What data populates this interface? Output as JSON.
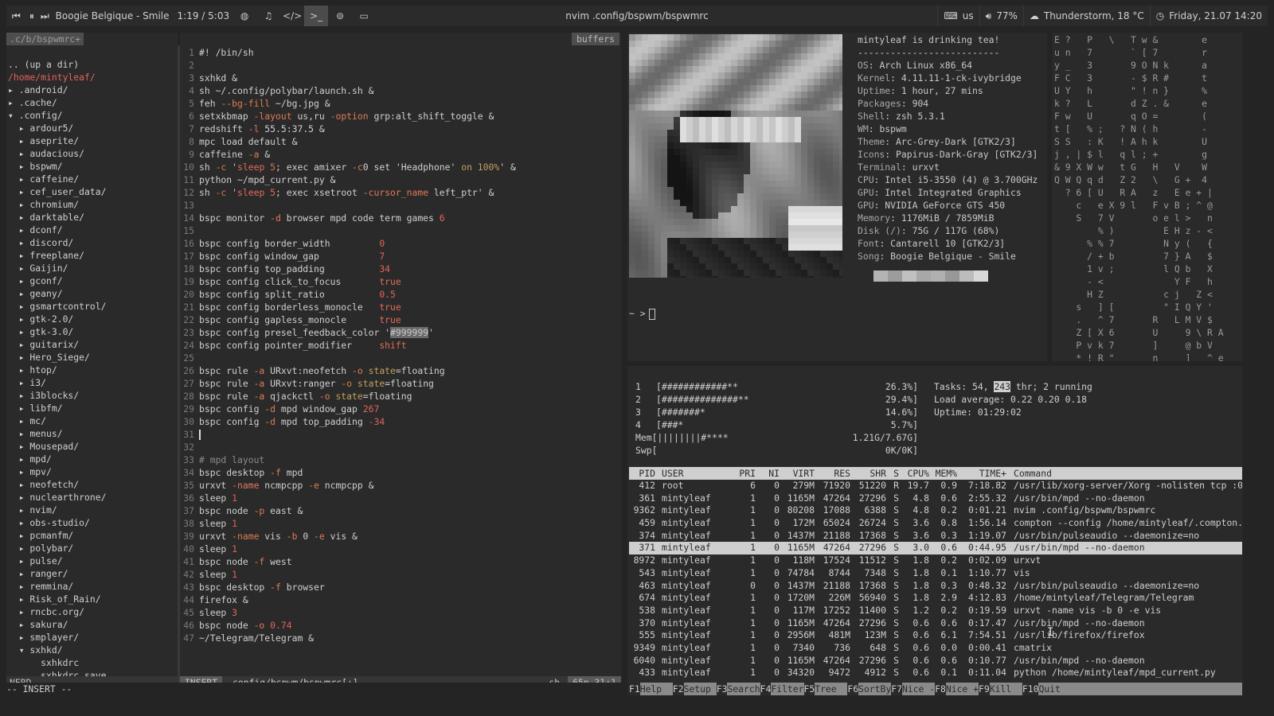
{
  "bar": {
    "song": "Boogie Belgique - Smile",
    "time": "1:19 / 5:03",
    "window_title": "nvim .config/bspwm/bspwmrc",
    "keyboard": "us",
    "volume": "77%",
    "weather": "Thunderstorm, 18 °C",
    "clock": "Friday, 21.07  14:20",
    "icons": [
      "prev-icon",
      "pause-icon",
      "next-icon",
      "globe-icon",
      "music-icon",
      "code-icon",
      "terminal-icon",
      "gamepad-icon",
      "desktop-icon",
      "keyboard-icon",
      "volume-icon",
      "weather-icon",
      "clock-icon"
    ]
  },
  "nerdtree": {
    "header": ".c/b/bspwmrc+",
    "up": ".. (up a dir)",
    "root": "/home/mintyleaf/",
    "items": [
      "▸ .android/",
      "▸ .cache/",
      "▾ .config/",
      "  ▸ ardour5/",
      "  ▸ aseprite/",
      "  ▸ audacious/",
      "  ▸ bspwm/",
      "  ▸ caffeine/",
      "  ▸ cef_user_data/",
      "  ▸ chromium/",
      "  ▸ darktable/",
      "  ▸ dconf/",
      "  ▸ discord/",
      "  ▸ freeplane/",
      "  ▸ Gaijin/",
      "  ▸ gconf/",
      "  ▸ geany/",
      "  ▸ gsmartcontrol/",
      "  ▸ gtk-2.0/",
      "  ▸ gtk-3.0/",
      "  ▸ guitarix/",
      "  ▸ Hero_Siege/",
      "  ▸ htop/",
      "  ▸ i3/",
      "  ▸ i3blocks/",
      "  ▸ libfm/",
      "  ▸ mc/",
      "  ▸ menus/",
      "  ▸ Mousepad/",
      "  ▸ mpd/",
      "  ▸ mpv/",
      "  ▸ neofetch/",
      "  ▸ nuclearthrone/",
      "  ▸ nvim/",
      "  ▸ obs-studio/",
      "  ▸ pcmanfm/",
      "  ▸ polybar/",
      "  ▸ pulse/",
      "  ▸ ranger/",
      "  ▸ remmina/",
      "  ▸ Risk_of_Rain/",
      "  ▸ rncbc.org/",
      "  ▸ sakura/",
      "  ▸ smplayer/",
      "  ▾ sxhkd/",
      "      sxhkdrc",
      "      sxhkdrc.save"
    ],
    "status": "NERD"
  },
  "editor": {
    "buffers_label": "buffers",
    "mode": "INSERT",
    "file": ".config/bspwm/bspwmrc[+]",
    "filetype": "sh",
    "position": "65p 31:1",
    "cmdline": "-- INSERT --",
    "lines": [
      "#! /bin/sh",
      "",
      "sxhkd &",
      "sh ~/.config/polybar/launch.sh &",
      "feh --bg-fill ~/bg.jpg &",
      "setxkbmap -layout us,ru -option grp:alt_shift_toggle &",
      "redshift -l 55.5:37.5 &",
      "mpc load default &",
      "caffeine -a &",
      "sh -c 'sleep 5; exec amixer -c0 set 'Headphone' on 100%' &",
      "python ~/mpd_current.py &",
      "sh -c 'sleep 5; exec xsetroot -cursor_name left_ptr' &",
      "",
      "bspc monitor -d browser mpd code term games 6",
      "",
      "bspc config border_width         0",
      "bspc config window_gap           7",
      "bspc config top_padding          34",
      "bspc config click_to_focus       true",
      "bspc config split_ratio          0.5",
      "bspc config borderless_monocle   true",
      "bspc config gapless_monocle      true",
      "bspc config presel_feedback_color '#999999'",
      "bspc config pointer_modifier     shift",
      "",
      "bspc rule -a URxvt:neofetch -o state=floating",
      "bspc rule -a URxvt:ranger -o state=floating",
      "bspc rule -a qjackctl -o state=floating",
      "bspc config -d mpd window_gap 267",
      "bspc config -d mpd top_padding -34",
      "",
      "",
      "# mpd layout",
      "bspc desktop -f mpd",
      "urxvt -name ncmpcpp -e ncmpcpp &",
      "sleep 1",
      "bspc node -p east &",
      "sleep 1",
      "urxvt -name vis -b 0 -e vis &",
      "sleep 1",
      "bspc node -f west",
      "sleep 1",
      "bspc desktop -f browser",
      "firefox &",
      "sleep 3",
      "bspc node -o 0.74",
      "~/Telegram/Telegram &"
    ]
  },
  "neofetch": {
    "title": "mintyleaf is drinking tea!",
    "rule": "--------------------------",
    "info": [
      {
        "k": "OS",
        "v": "Arch Linux x86_64"
      },
      {
        "k": "Kernel",
        "v": "4.11.11-1-ck-ivybridge"
      },
      {
        "k": "Uptime",
        "v": "1 hour, 27 mins"
      },
      {
        "k": "Packages",
        "v": "904"
      },
      {
        "k": "Shell",
        "v": "zsh 5.3.1"
      },
      {
        "k": "WM",
        "v": "bspwm"
      },
      {
        "k": "Theme",
        "v": "Arc-Grey-Dark [GTK2/3]"
      },
      {
        "k": "Icons",
        "v": "Papirus-Dark-Gray [GTK2/3]"
      },
      {
        "k": "Terminal",
        "v": "urxvt"
      },
      {
        "k": "CPU",
        "v": "Intel i5-3550 (4) @ 3.700GHz"
      },
      {
        "k": "GPU",
        "v": "Intel Integrated Graphics"
      },
      {
        "k": "GPU",
        "v": "NVIDIA GeForce GTS 450"
      },
      {
        "k": "Memory",
        "v": "1176MiB / 7859MiB"
      },
      {
        "k": "Disk (/)",
        "v": "75G / 117G (68%)"
      },
      {
        "k": "Font",
        "v": "Cantarell 10 [GTK2/3]"
      },
      {
        "k": "Song",
        "v": "Boogie Belgique - Smile"
      }
    ],
    "swatches": [
      "#b4b4b4",
      "#9c9c9c",
      "#c0c0c0",
      "#a8a8a8",
      "#b0b0b0",
      "#989898",
      "#bcbcbc",
      "#d8d8d8"
    ],
    "prompt": "~ >"
  },
  "matrix": {
    "lines": [
      "E ?   P   \\   T w &        e",
      "u n   7       ` [ 7        r",
      "y _   3       9 O N k      a",
      "F C   3       - $ R #      t",
      "U Y   h       \" ! n }      %",
      "k ?   L       d Z . &      e",
      "F w   U       q O =        (",
      "t [   % ;   ? N ( h        -",
      "S S   : K   ! A h k        U",
      "j , | $ l   q l ; +        g",
      "& 9 X W w   t G   H   V    W",
      "Q W Q q d   Z 2   \\   G +  4",
      "  ? 6 [ U   R A   z   E e + |",
      "    c   e X 9 l   F v B ; ^ @",
      "    S   7 V       o e l >   n",
      "        % )         E H z - <",
      "      % % 7         N y (   {",
      "      / + b         7 } A   $",
      "      1 v ;         l Q b   X",
      "      - <             Y F   h",
      "      H Z           c j   Z <",
      "    s   ] [         \" I Q Y '",
      "    .   ^ 7       R   L M V $",
      "    Z [ X 6       U     9 \\ R A",
      "    P v k 7       ]     @ b V",
      "    * ! R \"       n     ] _ ^ e"
    ]
  },
  "htop": {
    "cpus": [
      {
        "n": "1",
        "bar": "[############**",
        "pct": "26.3%]"
      },
      {
        "n": "2",
        "bar": "[##############**",
        "pct": "29.4%]"
      },
      {
        "n": "3",
        "bar": "[#######*",
        "pct": "14.6%]"
      },
      {
        "n": "4",
        "bar": "[###*",
        "pct": "5.7%]"
      }
    ],
    "mem": {
      "label": "Mem",
      "bar": "[||||||||#****",
      "val": "1.21G/7.67G]"
    },
    "swp": {
      "label": "Swp",
      "bar": "[",
      "val": "0K/0K]"
    },
    "tasks_prefix": "Tasks: 54, ",
    "threads": "243",
    "tasks_suffix": " thr; 2 running",
    "load": "Load average: 0.22 0.20 0.18",
    "uptime": "Uptime: 01:29:02",
    "headers": {
      "pid": "PID",
      "user": "USER",
      "pri": "PRI",
      "ni": "NI",
      "virt": "VIRT",
      "res": "RES",
      "shr": "SHR",
      "s": "S",
      "cpu": "CPU%",
      "mem": "MEM%",
      "time": "TIME+",
      "cmd": "Command"
    },
    "processes": [
      {
        "pid": "412",
        "user": "root",
        "pri": "6",
        "ni": "0",
        "virt": "279M",
        "res": "71920",
        "shr": "51220",
        "s": "R",
        "cpu": "19.7",
        "mem": "0.9",
        "time": "7:18.82",
        "cmd": "/usr/lib/xorg-server/Xorg -nolisten tcp :0 vt1 -a"
      },
      {
        "pid": "361",
        "user": "mintyleaf",
        "pri": "1",
        "ni": "0",
        "virt": "1165M",
        "res": "47264",
        "shr": "27296",
        "s": "S",
        "cpu": "4.8",
        "mem": "0.6",
        "time": "2:55.32",
        "cmd": "/usr/bin/mpd --no-daemon"
      },
      {
        "pid": "9362",
        "user": "mintyleaf",
        "pri": "1",
        "ni": "0",
        "virt": "80208",
        "res": "17088",
        "shr": "6388",
        "s": "S",
        "cpu": "4.8",
        "mem": "0.2",
        "time": "0:01.21",
        "cmd": "nvim .config/bspwm/bspwmrc"
      },
      {
        "pid": "459",
        "user": "mintyleaf",
        "pri": "1",
        "ni": "0",
        "virt": "172M",
        "res": "65024",
        "shr": "26724",
        "s": "S",
        "cpu": "3.6",
        "mem": "0.8",
        "time": "1:56.14",
        "cmd": "compton --config /home/mintyleaf/.compton.conf"
      },
      {
        "pid": "374",
        "user": "mintyleaf",
        "pri": "1",
        "ni": "0",
        "virt": "1437M",
        "res": "21188",
        "shr": "17368",
        "s": "S",
        "cpu": "3.6",
        "mem": "0.3",
        "time": "1:19.07",
        "cmd": "/usr/bin/pulseaudio --daemonize=no"
      },
      {
        "pid": "371",
        "user": "mintyleaf",
        "pri": "1",
        "ni": "0",
        "virt": "1165M",
        "res": "47264",
        "shr": "27296",
        "s": "S",
        "cpu": "3.0",
        "mem": "0.6",
        "time": "0:44.95",
        "cmd": "/usr/bin/mpd --no-daemon"
      },
      {
        "pid": "8972",
        "user": "mintyleaf",
        "pri": "1",
        "ni": "0",
        "virt": "118M",
        "res": "17524",
        "shr": "11512",
        "s": "S",
        "cpu": "1.8",
        "mem": "0.2",
        "time": "0:02.09",
        "cmd": "urxvt"
      },
      {
        "pid": "543",
        "user": "mintyleaf",
        "pri": "1",
        "ni": "0",
        "virt": "74784",
        "res": "8744",
        "shr": "7348",
        "s": "S",
        "cpu": "1.8",
        "mem": "0.1",
        "time": "1:10.77",
        "cmd": "vis"
      },
      {
        "pid": "463",
        "user": "mintyleaf",
        "pri": "0",
        "ni": "0",
        "virt": "1437M",
        "res": "21188",
        "shr": "17368",
        "s": "S",
        "cpu": "1.8",
        "mem": "0.3",
        "time": "0:48.32",
        "cmd": "/usr/bin/pulseaudio --daemonize=no"
      },
      {
        "pid": "674",
        "user": "mintyleaf",
        "pri": "1",
        "ni": "0",
        "virt": "1720M",
        "res": "226M",
        "shr": "56940",
        "s": "S",
        "cpu": "1.8",
        "mem": "2.9",
        "time": "4:12.83",
        "cmd": "/home/mintyleaf/Telegram/Telegram"
      },
      {
        "pid": "538",
        "user": "mintyleaf",
        "pri": "1",
        "ni": "0",
        "virt": "117M",
        "res": "17252",
        "shr": "11400",
        "s": "S",
        "cpu": "1.2",
        "mem": "0.2",
        "time": "0:19.59",
        "cmd": "urxvt -name vis -b 0 -e vis"
      },
      {
        "pid": "370",
        "user": "mintyleaf",
        "pri": "1",
        "ni": "0",
        "virt": "1165M",
        "res": "47264",
        "shr": "27296",
        "s": "S",
        "cpu": "0.6",
        "mem": "0.6",
        "time": "0:17.47",
        "cmd": "/usr/bin/mpd --no-daemon"
      },
      {
        "pid": "555",
        "user": "mintyleaf",
        "pri": "1",
        "ni": "0",
        "virt": "2956M",
        "res": "481M",
        "shr": "123M",
        "s": "S",
        "cpu": "0.6",
        "mem": "6.1",
        "time": "7:54.51",
        "cmd": "/usr/lib/firefox/firefox"
      },
      {
        "pid": "9349",
        "user": "mintyleaf",
        "pri": "1",
        "ni": "0",
        "virt": "7340",
        "res": "736",
        "shr": "648",
        "s": "S",
        "cpu": "0.6",
        "mem": "0.0",
        "time": "0:00.41",
        "cmd": "cmatrix"
      },
      {
        "pid": "6040",
        "user": "mintyleaf",
        "pri": "1",
        "ni": "0",
        "virt": "1165M",
        "res": "47264",
        "shr": "27296",
        "s": "S",
        "cpu": "0.6",
        "mem": "0.6",
        "time": "0:10.77",
        "cmd": "/usr/bin/mpd --no-daemon"
      },
      {
        "pid": "433",
        "user": "mintyleaf",
        "pri": "1",
        "ni": "0",
        "virt": "34320",
        "res": "9472",
        "shr": "4912",
        "s": "S",
        "cpu": "0.6",
        "mem": "0.1",
        "time": "0:11.04",
        "cmd": "python /home/mintyleaf/mpd_current.py"
      }
    ],
    "selected_index": 5,
    "fkeys": [
      {
        "f": "F1",
        "l": "Help  "
      },
      {
        "f": "F2",
        "l": "Setup "
      },
      {
        "f": "F3",
        "l": "Search"
      },
      {
        "f": "F4",
        "l": "Filter"
      },
      {
        "f": "F5",
        "l": "Tree  "
      },
      {
        "f": "F6",
        "l": "SortBy"
      },
      {
        "f": "F7",
        "l": "Nice -"
      },
      {
        "f": "F8",
        "l": "Nice +"
      },
      {
        "f": "F9",
        "l": "Kill  "
      },
      {
        "f": "F10",
        "l": "Quit"
      }
    ]
  }
}
